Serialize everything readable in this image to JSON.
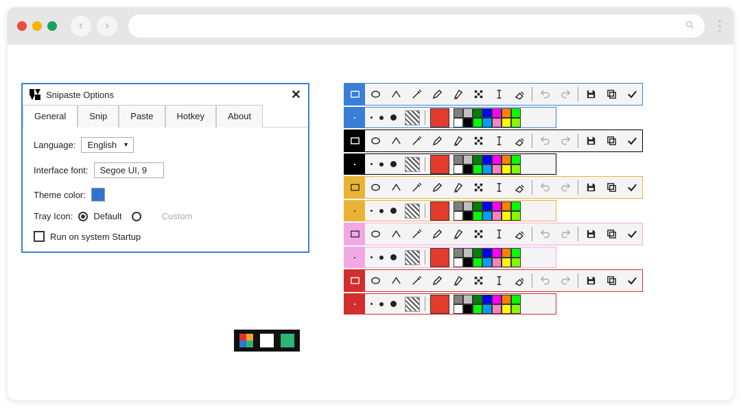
{
  "dialog": {
    "title": "Snipaste Options",
    "tabs": [
      "General",
      "Snip",
      "Paste",
      "Hotkey",
      "About"
    ],
    "active_tab": 0,
    "language_label": "Language:",
    "language_value": "English",
    "font_label": "Interface font:",
    "font_value": "Segoe UI, 9",
    "theme_label": "Theme color:",
    "theme_color": "#2f74d0",
    "tray_label": "Tray Icon:",
    "tray_default": "Default",
    "tray_custom": "Custom",
    "startup_label": "Run on system Startup"
  },
  "toolbar_themes": [
    {
      "name": "blue",
      "border": "#3a7ed8",
      "header_bg": "#3a7ed8",
      "header_text": "#ffffff",
      "shape": "rect"
    },
    {
      "name": "black",
      "border": "#000000",
      "header_bg": "#000000",
      "header_text": "#ffffff",
      "shape": "rect"
    },
    {
      "name": "yellow",
      "border": "#e9b436",
      "header_bg": "#e9b436",
      "header_text": "#333333",
      "shape": "rect"
    },
    {
      "name": "pink",
      "border": "#f2a8e4",
      "header_bg": "#f2a8e4",
      "header_text": "#333333",
      "shape": "rect"
    },
    {
      "name": "red",
      "border": "#d22e2e",
      "header_bg": "#d22e2e",
      "header_text": "#ffffff",
      "shape": "rect"
    }
  ],
  "tool_icons": [
    "rect",
    "oval",
    "line",
    "picker",
    "pencil",
    "highlighter",
    "mosaic",
    "text",
    "eraser",
    "undo",
    "redo",
    "save",
    "copy",
    "done"
  ],
  "palette_big": "#e53b2c",
  "palette": {
    "row1": [
      "#808080",
      "#c0c0c0",
      "#008000",
      "#0000ff",
      "#ff00ff",
      "#ff8000",
      "#00ff00"
    ],
    "row2": [
      "#ffffff",
      "#000000",
      "#00ff00",
      "#00a0ff",
      "#ff80c0",
      "#ffff00",
      "#80ff00"
    ]
  },
  "tray_variants": [
    [
      "#e03131",
      "#f5a524",
      "#2f74d0",
      "#2bb673"
    ],
    [
      "#ffffff",
      "#ffffff",
      "#ffffff",
      "#ffffff"
    ],
    [
      "#2bb673",
      "#2bb673",
      "#2bb673",
      "#2bb673"
    ]
  ]
}
